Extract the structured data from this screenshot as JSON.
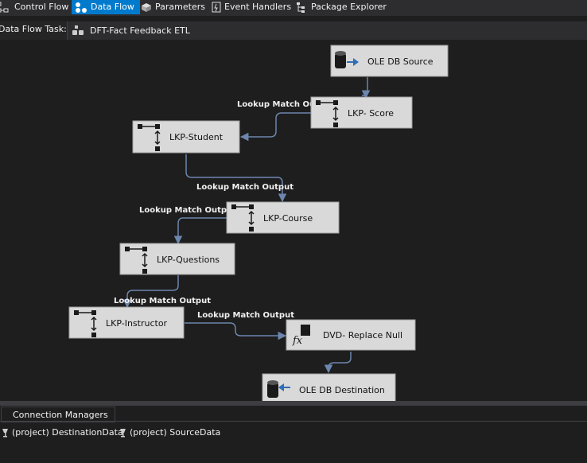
{
  "tabs": [
    {
      "label": "Control Flow",
      "active": false
    },
    {
      "label": "Data Flow",
      "active": true
    },
    {
      "label": "Parameters",
      "active": false
    },
    {
      "label": "Event Handlers",
      "active": false
    },
    {
      "label": "Package Explorer",
      "active": false
    }
  ],
  "task": {
    "label": "Data Flow Task:",
    "value": "DFT-Fact Feedback ETL"
  },
  "components": [
    {
      "id": "ole-db-source",
      "label": "OLE DB Source",
      "icon": "source-icon"
    },
    {
      "id": "lkp-score",
      "label": "LKP- Score",
      "icon": "lookup-icon"
    },
    {
      "id": "lkp-student",
      "label": "LKP-Student",
      "icon": "lookup-icon"
    },
    {
      "id": "lkp-course",
      "label": "LKP-Course",
      "icon": "lookup-icon"
    },
    {
      "id": "lkp-questions",
      "label": "LKP-Questions",
      "icon": "lookup-icon"
    },
    {
      "id": "lkp-instructor",
      "label": "LKP-Instructor",
      "icon": "lookup-icon"
    },
    {
      "id": "dvd-replace-null",
      "label": "DVD- Replace Null",
      "icon": "derived-column-icon"
    },
    {
      "id": "ole-db-destination",
      "label": "OLE DB Destination",
      "icon": "destination-icon"
    }
  ],
  "path_labels": [
    "Lookup Match Output",
    "Lookup Match Output",
    "Lookup Match Output",
    "Lookup Match Output",
    "Lookup Match Output"
  ],
  "connection_managers": {
    "tab_label": "Connection Managers",
    "items": [
      "(project) DestinationData",
      "(project) SourceData"
    ]
  }
}
